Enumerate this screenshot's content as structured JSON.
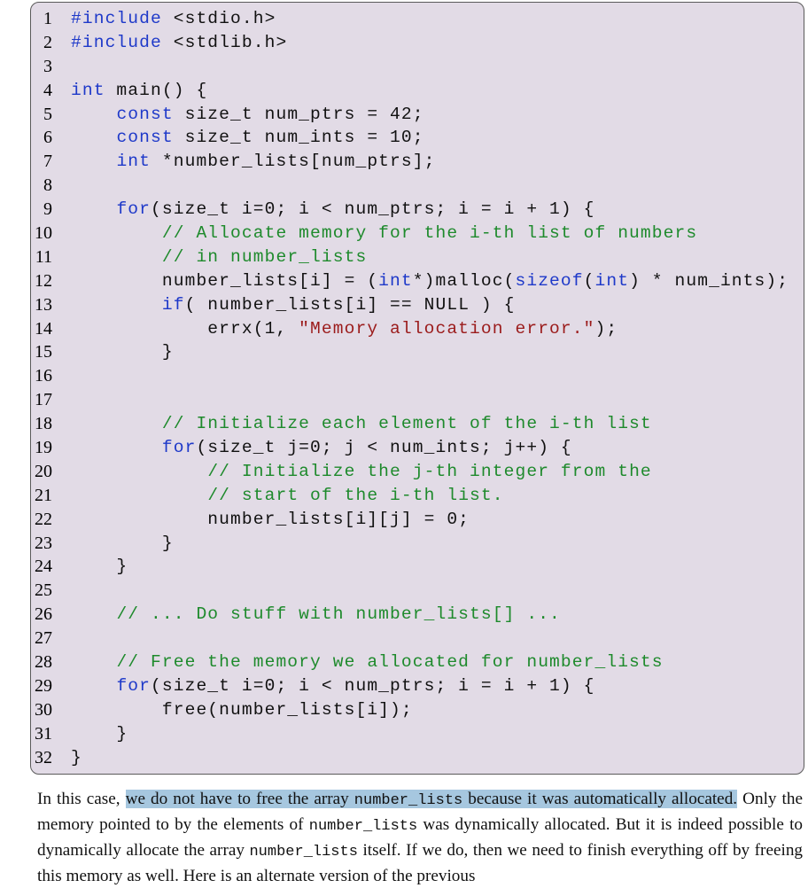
{
  "line_numbers": [
    "1",
    "2",
    "3",
    "4",
    "5",
    "6",
    "7",
    "8",
    "9",
    "10",
    "11",
    "12",
    "13",
    "14",
    "15",
    "16",
    "17",
    "18",
    "19",
    "20",
    "21",
    "22",
    "23",
    "24",
    "25",
    "26",
    "27",
    "28",
    "29",
    "30",
    "31",
    "32"
  ],
  "code_lines": [
    "#include <stdio.h>",
    "#include <stdlib.h>",
    "",
    "int main() {",
    "    const size_t num_ptrs = 42;",
    "    const size_t num_ints = 10;",
    "    int *number_lists[num_ptrs];",
    "",
    "    for(size_t i=0; i < num_ptrs; i = i + 1) {",
    "        // Allocate memory for the i-th list of numbers",
    "        // in number_lists",
    "        number_lists[i] = (int*)malloc(sizeof(int) * num_ints);",
    "        if( number_lists[i] == NULL ) {",
    "            errx(1, \"Memory allocation error.\");",
    "        }",
    "",
    "",
    "        // Initialize each element of the i-th list",
    "        for(size_t j=0; j < num_ints; j++) {",
    "            // Initialize the j-th integer from the",
    "            // start of the i-th list.",
    "            number_lists[i][j] = 0;",
    "        }",
    "    }",
    "",
    "    // ... Do stuff with number_lists[] ...",
    "",
    "    // Free the memory we allocated for number_lists",
    "    for(size_t i=0; i < num_ptrs; i = i + 1) {",
    "        free(number_lists[i]);",
    "    }",
    "}"
  ],
  "prose": {
    "p1_intro": "In this case, ",
    "p1_hl_a": "we do not have to free the array ",
    "p1_hl_code": "number_lists",
    "p1_hl_b": " because it was automatically allocated.",
    "p1_s2a": " Only the memory pointed to by the elements of ",
    "p1_code2": "number_lists",
    "p1_s2b": " was dynamically allocated. But it is indeed possible to dynamically allocate the array ",
    "p1_code3": "number_lists",
    "p1_s3": " itself. If we do, then we need to finish everything off by freeing this memory as well. Here is an alternate version of the previous"
  },
  "colors": {
    "code_background": "#e2dbe6",
    "keyword": "#1e39c9",
    "comment": "#1e8a2c",
    "string": "#9b1b1b",
    "highlight": "#a6c7df"
  }
}
